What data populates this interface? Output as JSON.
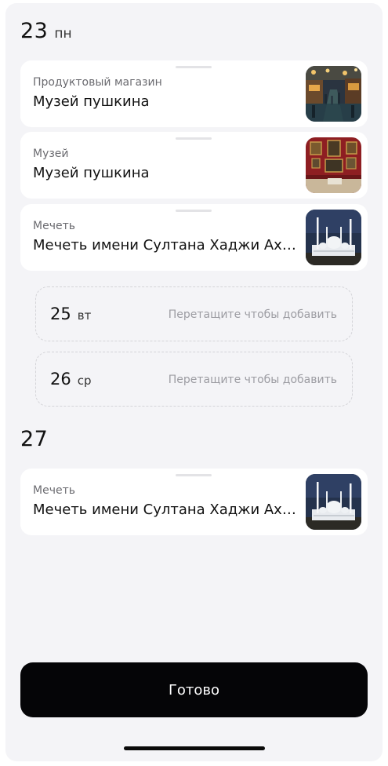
{
  "days": [
    {
      "number": "23",
      "weekday": "пн"
    },
    {
      "number": "27",
      "weekday": ""
    }
  ],
  "cards": [
    {
      "category": "Продуктовый магазин",
      "title": "Музей пушкина",
      "image": "market-photo"
    },
    {
      "category": "Музей",
      "title": "Музей пушкина",
      "image": "museum-gallery-photo"
    },
    {
      "category": "Мечеть",
      "title": "Мечеть имени Султана Хаджи Ахмеда",
      "image": "mosque-photo"
    },
    {
      "category": "Мечеть",
      "title": "Мечеть имени Султана Хаджи Ахмеда",
      "image": "mosque-photo"
    }
  ],
  "dropzones": [
    {
      "number": "25",
      "weekday": "вт",
      "hint": "Перетащите чтобы добавить"
    },
    {
      "number": "26",
      "weekday": "ср",
      "hint": "Перетащите чтобы добавить"
    }
  ],
  "done_label": "Готово"
}
